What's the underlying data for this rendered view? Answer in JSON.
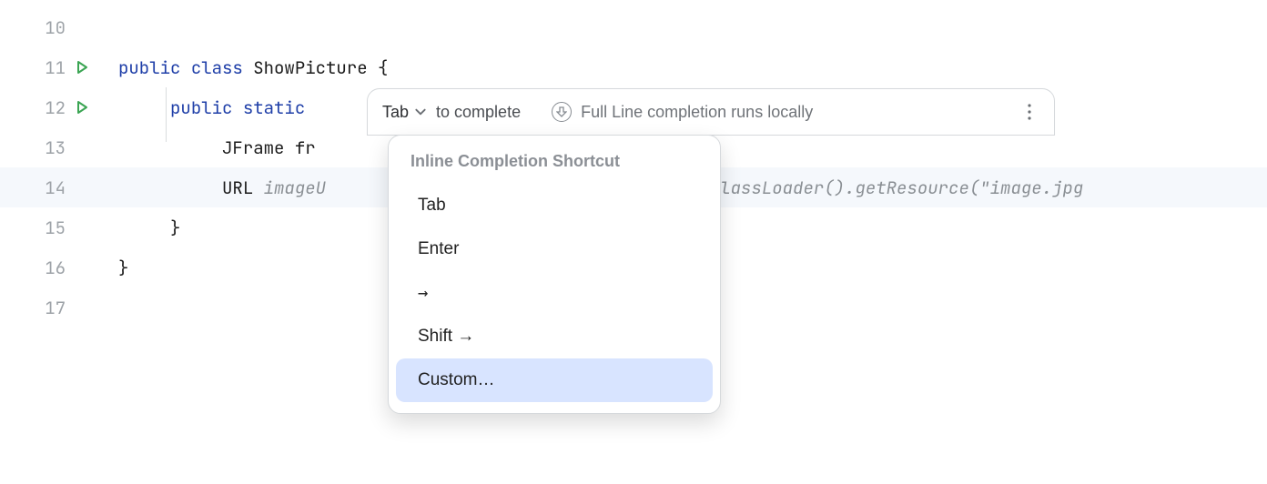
{
  "gutter": {
    "lines": [
      "10",
      "11",
      "12",
      "13",
      "14",
      "15",
      "16",
      "17"
    ],
    "runnable_lines": [
      11,
      12
    ],
    "current_line": 14
  },
  "code": {
    "l11_kw1": "public",
    "l11_kw2": "class",
    "l11_name": "ShowPicture",
    "l11_brace": "{",
    "l12_kw1": "public",
    "l12_kw2": "static",
    "l13_type": "JFrame",
    "l13_var": "fr",
    "l14_type": "URL",
    "l14_var": "imageU",
    "l14_ghost_tail": "etClassLoader().getResource(",
    "l14_str": "\"image.jpg",
    "l15_brace": "}",
    "l16_brace": "}"
  },
  "hint": {
    "key": "Tab",
    "label": "to complete",
    "info": "Full Line completion runs locally"
  },
  "dropdown": {
    "header": "Inline Completion Shortcut",
    "items": [
      "Tab",
      "Enter",
      "→",
      "Shift →",
      "Custom…"
    ],
    "selected_index": 4
  }
}
